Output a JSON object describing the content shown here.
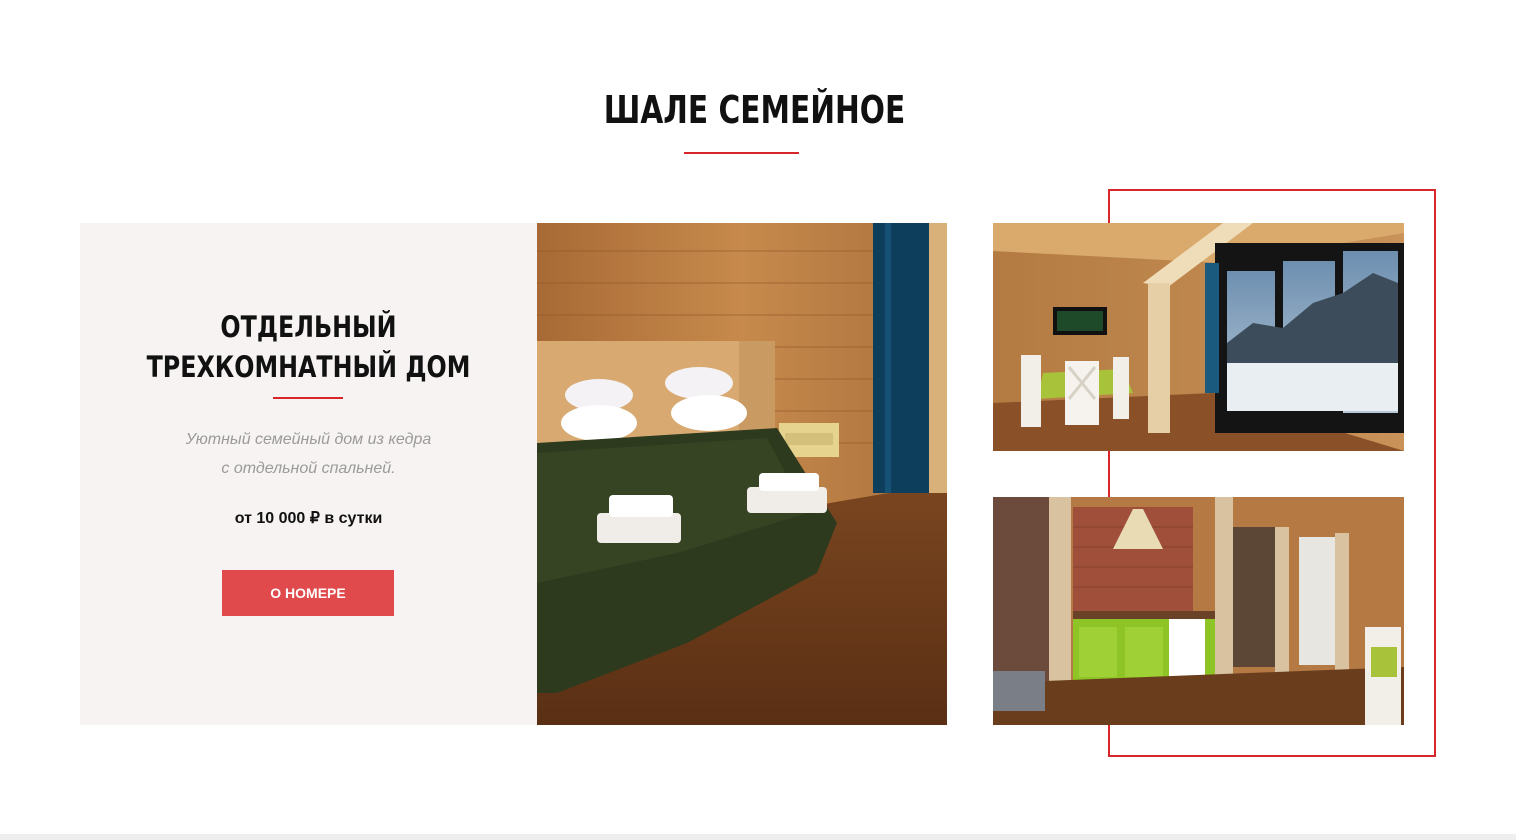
{
  "section": {
    "title": "ШАЛЕ СЕМЕЙНОЕ"
  },
  "card": {
    "heading_line1": "ОТДЕЛЬНЫЙ",
    "heading_line2": "ТРЕХКОМНАТНЫЙ ДОМ",
    "description_line1": "Уютный семейный дом из кедра",
    "description_line2": "с отдельной спальней.",
    "price": "от 10 000 ₽ в сутки",
    "button_label": "О НОМЕРЕ"
  },
  "colors": {
    "accent": "#d9262b",
    "button": "#e04a4c",
    "card_bg": "#f6f3f2"
  },
  "photos": [
    {
      "name": "bedroom-photo"
    },
    {
      "name": "dining-room-photo"
    },
    {
      "name": "kitchen-photo"
    }
  ]
}
